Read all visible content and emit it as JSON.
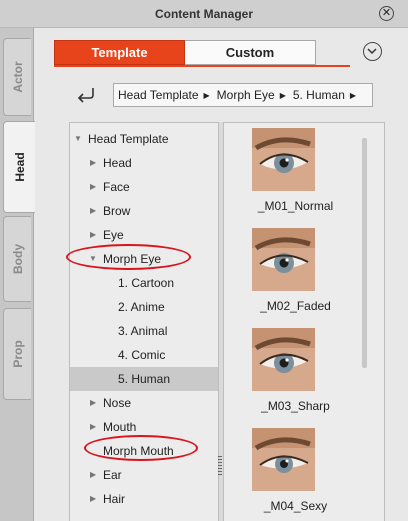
{
  "window": {
    "title": "Content Manager",
    "close_icon": "close-icon"
  },
  "side_tabs": [
    {
      "label": "Actor",
      "active": false
    },
    {
      "label": "Head",
      "active": true
    },
    {
      "label": "Body",
      "active": false
    },
    {
      "label": "Prop",
      "active": false
    }
  ],
  "top_tabs": {
    "template": "Template",
    "custom": "Custom",
    "active": "Template"
  },
  "toolbar": {
    "dropdown_icon": "chevron-down-circle-icon",
    "back_icon": "back-arrow-icon"
  },
  "breadcrumb": [
    "Head Template",
    "Morph Eye",
    "5. Human"
  ],
  "tree": {
    "items": [
      {
        "label": "Head Template",
        "expanded": true
      },
      {
        "label": "Head"
      },
      {
        "label": "Face"
      },
      {
        "label": "Brow"
      },
      {
        "label": "Eye"
      },
      {
        "label": "Morph Eye",
        "expanded": true
      },
      {
        "label": "1. Cartoon"
      },
      {
        "label": "2. Anime"
      },
      {
        "label": "3. Animal"
      },
      {
        "label": "4. Comic"
      },
      {
        "label": "5. Human",
        "selected": true
      },
      {
        "label": "Nose"
      },
      {
        "label": "Mouth"
      },
      {
        "label": "Morph Mouth"
      },
      {
        "label": "Ear"
      },
      {
        "label": "Hair"
      }
    ]
  },
  "thumbnails": [
    {
      "label": "_M01_Normal"
    },
    {
      "label": "_M02_Faded"
    },
    {
      "label": "_M03_Sharp"
    },
    {
      "label": "_M04_Sexy"
    }
  ],
  "annotation_color": "#d8141c",
  "accent_color": "#e8441c"
}
